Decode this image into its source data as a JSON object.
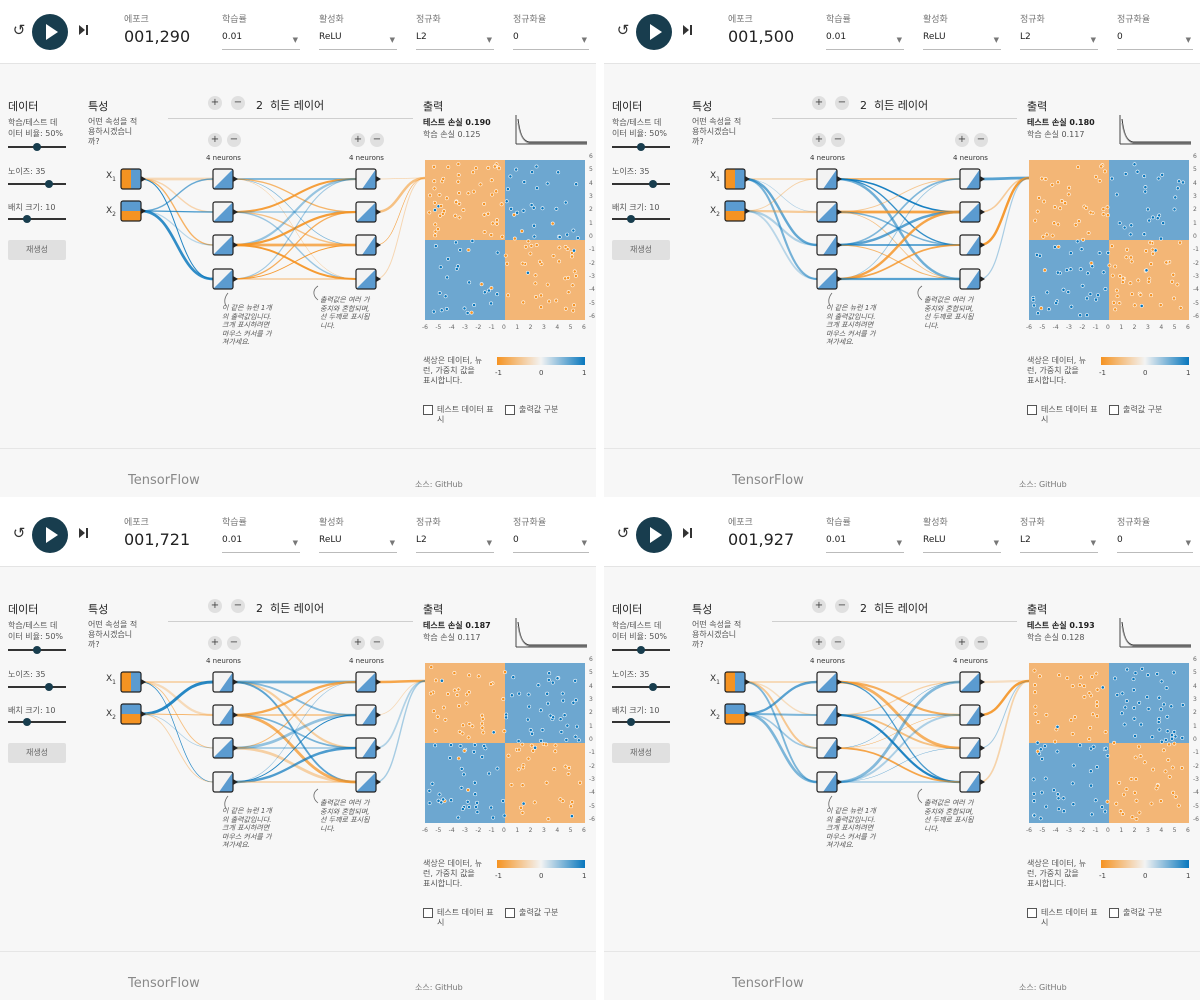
{
  "labels": {
    "epoch": "에포크",
    "learning_rate": "학습률",
    "activation": "활성화",
    "regularization": "정규화",
    "reg_rate": "정규화율",
    "data_title": "데이터",
    "ratio_line1": "학습/테스트 데",
    "ratio_line2": "이터 비율:",
    "noise": "노이즈:",
    "batch": "배치 크기:",
    "regenerate": "재생성",
    "features_title": "특성",
    "features_q1": "어떤 속성을 적",
    "features_q2": "용하시겠습니",
    "features_q3": "까?",
    "hidden_layers_count": "2",
    "hidden_layers_text": "히든 레이어",
    "neurons": "4 neurons",
    "plus": "+",
    "minus": "−",
    "x1": "X",
    "x1_sub": "1",
    "x2": "X",
    "x2_sub": "2",
    "ann1_l1": "이 같은 뉴런 1개",
    "ann1_l2": "의 출력값입니다.",
    "ann1_l3": "크게 표시하려면",
    "ann1_l4": "마우스 커서를 가",
    "ann1_l5": "져가세요.",
    "ann2_l1": "출력값은 여러 가",
    "ann2_l2": "중치와 혼합되며,",
    "ann2_l3": "선 두께로 표시됩",
    "ann2_l4": "니다.",
    "output_title": "출력",
    "test_loss": "테스트 손실",
    "train_loss": "학습 손실",
    "color_desc1": "색상은 데이터, 뉴",
    "color_desc2": "런, 가중치 값을",
    "color_desc3": "표시합니다.",
    "legend_min": "-1",
    "legend_mid": "0",
    "legend_max": "1",
    "show_test_l1": "테스트 데이터 표",
    "show_test_l2": "시",
    "discretize": "출력값 구분",
    "tensorflow": "TensorFlow",
    "source": "소스: GitHub",
    "reset_icon": "↺"
  },
  "axis_ticks": [
    "-6",
    "-5",
    "-4",
    "-3",
    "-2",
    "-1",
    "0",
    "1",
    "2",
    "3",
    "4",
    "5",
    "6"
  ],
  "colors": {
    "orange": "#f59322",
    "blue": "#0877bd",
    "play_bg": "#183d4e",
    "heat_orange": "#f3b676",
    "heat_blue": "#6da7d0"
  },
  "panels": [
    {
      "epoch": "001,290",
      "learning_rate": "0.01",
      "activation": "ReLU",
      "regularization": "L2",
      "reg_rate": "0",
      "ratio": "50%",
      "ratio_level": 0.5,
      "noise": "35",
      "noise_level": 0.7,
      "batch": "10",
      "batch_level": 0.33,
      "test_loss": "0.190",
      "train_loss": "0.125"
    },
    {
      "epoch": "001,500",
      "learning_rate": "0.01",
      "activation": "ReLU",
      "regularization": "L2",
      "reg_rate": "0",
      "ratio": "50%",
      "ratio_level": 0.5,
      "noise": "35",
      "noise_level": 0.7,
      "batch": "10",
      "batch_level": 0.33,
      "test_loss": "0.180",
      "train_loss": "0.117"
    },
    {
      "epoch": "001,721",
      "learning_rate": "0.01",
      "activation": "ReLU",
      "regularization": "L2",
      "reg_rate": "0",
      "ratio": "50%",
      "ratio_level": 0.5,
      "noise": "35",
      "noise_level": 0.7,
      "batch": "10",
      "batch_level": 0.33,
      "test_loss": "0.187",
      "train_loss": "0.117"
    },
    {
      "epoch": "001,927",
      "learning_rate": "0.01",
      "activation": "ReLU",
      "regularization": "L2",
      "reg_rate": "0",
      "ratio": "50%",
      "ratio_level": 0.5,
      "noise": "35",
      "noise_level": 0.7,
      "batch": "10",
      "batch_level": 0.33,
      "test_loss": "0.193",
      "train_loss": "0.128"
    }
  ]
}
